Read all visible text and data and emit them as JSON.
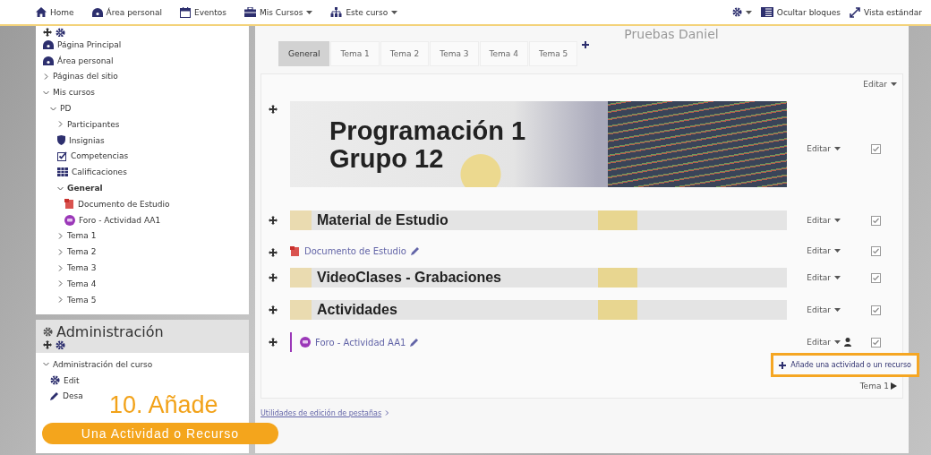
{
  "navbar": {
    "left": [
      {
        "label": "Home",
        "kind": "home",
        "caret": false
      },
      {
        "label": "Área personal",
        "kind": "dashboard",
        "caret": false
      },
      {
        "label": "Eventos",
        "kind": "calendar",
        "caret": false
      },
      {
        "label": "Mis Cursos",
        "kind": "briefcase",
        "caret": true
      },
      {
        "label": "Este curso",
        "kind": "sitemap",
        "caret": true
      }
    ],
    "right": [
      {
        "label": "Ocultar bloques",
        "kind": "blocks"
      },
      {
        "label": "Vista estándar",
        "kind": "expand"
      }
    ]
  },
  "navigation": {
    "items": [
      {
        "label": "Página Principal",
        "kind": "dashboard"
      },
      {
        "label": "Área personal",
        "kind": "dashboard"
      },
      {
        "label": "Páginas del sitio",
        "expanded": false
      },
      {
        "label": "Mis cursos",
        "expanded": true,
        "children": [
          {
            "label": "PD",
            "expanded": true,
            "children": [
              {
                "label": "Participantes",
                "expanded": false
              },
              {
                "label": "Insignias",
                "kind": "badge"
              },
              {
                "label": "Competencias",
                "kind": "check"
              },
              {
                "label": "Calificaciones",
                "kind": "table"
              },
              {
                "label": "General",
                "expanded": true,
                "current": true,
                "children": [
                  {
                    "label": "Documento de Estudio",
                    "kind": "pdf"
                  },
                  {
                    "label": "Foro - Actividad AA1",
                    "kind": "forum"
                  }
                ]
              },
              {
                "label": "Tema 1",
                "expanded": false
              },
              {
                "label": "Tema 2",
                "expanded": false
              },
              {
                "label": "Tema 3",
                "expanded": false
              },
              {
                "label": "Tema 4",
                "expanded": false
              },
              {
                "label": "Tema 5",
                "expanded": false
              }
            ]
          }
        ]
      }
    ]
  },
  "administration": {
    "title": "Administración",
    "items": [
      {
        "label": "Administración del curso",
        "expanded": true,
        "children": [
          {
            "label": "Edit",
            "kind": "gear"
          },
          {
            "label": "Desa",
            "kind": "pencil"
          }
        ]
      }
    ]
  },
  "course": {
    "title": "Pruebas Daniel",
    "tabs": [
      {
        "label": "General",
        "selected": true
      },
      {
        "label": "Tema 1",
        "selected": false
      },
      {
        "label": "Tema 2",
        "selected": false
      },
      {
        "label": "Tema 3",
        "selected": false
      },
      {
        "label": "Tema 4",
        "selected": false
      },
      {
        "label": "Tema 5",
        "selected": false
      }
    ],
    "section_edit": "Editar",
    "rows": [
      {
        "kind": "hero",
        "lines": [
          "Programación 1",
          "Grupo 12"
        ],
        "edit": "Editar",
        "group_mode": false
      },
      {
        "kind": "banner",
        "title": "Material de Estudio",
        "edit": "Editar",
        "group_mode": false
      },
      {
        "kind": "document",
        "title": "Documento de Estudio",
        "edit": "Editar",
        "group_mode": false
      },
      {
        "kind": "banner",
        "title": "VideoClases - Grabaciones",
        "edit": "Editar",
        "group_mode": false
      },
      {
        "kind": "banner",
        "title": "Actividades",
        "edit": "Editar",
        "group_mode": false
      },
      {
        "kind": "forum",
        "title": "Foro - Actividad AA1",
        "edit": "Editar",
        "group_mode": true
      }
    ],
    "add_activity": "Añade una actividad o un recurso",
    "next_section": "Tema 1",
    "utilities": "Utilidades de edición de pestañas"
  },
  "overlay": {
    "step": "10. Añade",
    "caption": "Una Actividad o Recurso"
  }
}
